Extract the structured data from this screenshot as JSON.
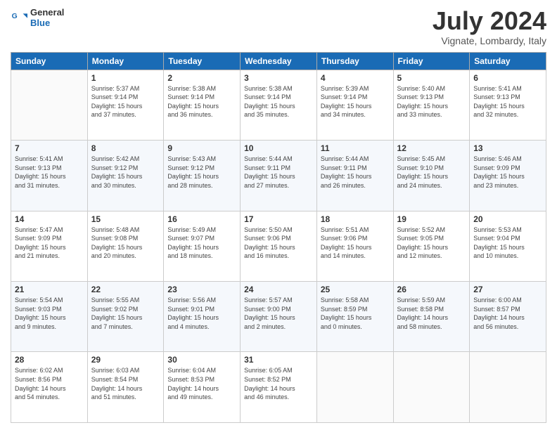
{
  "logo": {
    "line1": "General",
    "line2": "Blue"
  },
  "title": "July 2024",
  "location": "Vignate, Lombardy, Italy",
  "days_of_week": [
    "Sunday",
    "Monday",
    "Tuesday",
    "Wednesday",
    "Thursday",
    "Friday",
    "Saturday"
  ],
  "weeks": [
    [
      {
        "day": "",
        "info": ""
      },
      {
        "day": "1",
        "info": "Sunrise: 5:37 AM\nSunset: 9:14 PM\nDaylight: 15 hours\nand 37 minutes."
      },
      {
        "day": "2",
        "info": "Sunrise: 5:38 AM\nSunset: 9:14 PM\nDaylight: 15 hours\nand 36 minutes."
      },
      {
        "day": "3",
        "info": "Sunrise: 5:38 AM\nSunset: 9:14 PM\nDaylight: 15 hours\nand 35 minutes."
      },
      {
        "day": "4",
        "info": "Sunrise: 5:39 AM\nSunset: 9:14 PM\nDaylight: 15 hours\nand 34 minutes."
      },
      {
        "day": "5",
        "info": "Sunrise: 5:40 AM\nSunset: 9:13 PM\nDaylight: 15 hours\nand 33 minutes."
      },
      {
        "day": "6",
        "info": "Sunrise: 5:41 AM\nSunset: 9:13 PM\nDaylight: 15 hours\nand 32 minutes."
      }
    ],
    [
      {
        "day": "7",
        "info": "Sunrise: 5:41 AM\nSunset: 9:13 PM\nDaylight: 15 hours\nand 31 minutes."
      },
      {
        "day": "8",
        "info": "Sunrise: 5:42 AM\nSunset: 9:12 PM\nDaylight: 15 hours\nand 30 minutes."
      },
      {
        "day": "9",
        "info": "Sunrise: 5:43 AM\nSunset: 9:12 PM\nDaylight: 15 hours\nand 28 minutes."
      },
      {
        "day": "10",
        "info": "Sunrise: 5:44 AM\nSunset: 9:11 PM\nDaylight: 15 hours\nand 27 minutes."
      },
      {
        "day": "11",
        "info": "Sunrise: 5:44 AM\nSunset: 9:11 PM\nDaylight: 15 hours\nand 26 minutes."
      },
      {
        "day": "12",
        "info": "Sunrise: 5:45 AM\nSunset: 9:10 PM\nDaylight: 15 hours\nand 24 minutes."
      },
      {
        "day": "13",
        "info": "Sunrise: 5:46 AM\nSunset: 9:09 PM\nDaylight: 15 hours\nand 23 minutes."
      }
    ],
    [
      {
        "day": "14",
        "info": "Sunrise: 5:47 AM\nSunset: 9:09 PM\nDaylight: 15 hours\nand 21 minutes."
      },
      {
        "day": "15",
        "info": "Sunrise: 5:48 AM\nSunset: 9:08 PM\nDaylight: 15 hours\nand 20 minutes."
      },
      {
        "day": "16",
        "info": "Sunrise: 5:49 AM\nSunset: 9:07 PM\nDaylight: 15 hours\nand 18 minutes."
      },
      {
        "day": "17",
        "info": "Sunrise: 5:50 AM\nSunset: 9:06 PM\nDaylight: 15 hours\nand 16 minutes."
      },
      {
        "day": "18",
        "info": "Sunrise: 5:51 AM\nSunset: 9:06 PM\nDaylight: 15 hours\nand 14 minutes."
      },
      {
        "day": "19",
        "info": "Sunrise: 5:52 AM\nSunset: 9:05 PM\nDaylight: 15 hours\nand 12 minutes."
      },
      {
        "day": "20",
        "info": "Sunrise: 5:53 AM\nSunset: 9:04 PM\nDaylight: 15 hours\nand 10 minutes."
      }
    ],
    [
      {
        "day": "21",
        "info": "Sunrise: 5:54 AM\nSunset: 9:03 PM\nDaylight: 15 hours\nand 9 minutes."
      },
      {
        "day": "22",
        "info": "Sunrise: 5:55 AM\nSunset: 9:02 PM\nDaylight: 15 hours\nand 7 minutes."
      },
      {
        "day": "23",
        "info": "Sunrise: 5:56 AM\nSunset: 9:01 PM\nDaylight: 15 hours\nand 4 minutes."
      },
      {
        "day": "24",
        "info": "Sunrise: 5:57 AM\nSunset: 9:00 PM\nDaylight: 15 hours\nand 2 minutes."
      },
      {
        "day": "25",
        "info": "Sunrise: 5:58 AM\nSunset: 8:59 PM\nDaylight: 15 hours\nand 0 minutes."
      },
      {
        "day": "26",
        "info": "Sunrise: 5:59 AM\nSunset: 8:58 PM\nDaylight: 14 hours\nand 58 minutes."
      },
      {
        "day": "27",
        "info": "Sunrise: 6:00 AM\nSunset: 8:57 PM\nDaylight: 14 hours\nand 56 minutes."
      }
    ],
    [
      {
        "day": "28",
        "info": "Sunrise: 6:02 AM\nSunset: 8:56 PM\nDaylight: 14 hours\nand 54 minutes."
      },
      {
        "day": "29",
        "info": "Sunrise: 6:03 AM\nSunset: 8:54 PM\nDaylight: 14 hours\nand 51 minutes."
      },
      {
        "day": "30",
        "info": "Sunrise: 6:04 AM\nSunset: 8:53 PM\nDaylight: 14 hours\nand 49 minutes."
      },
      {
        "day": "31",
        "info": "Sunrise: 6:05 AM\nSunset: 8:52 PM\nDaylight: 14 hours\nand 46 minutes."
      },
      {
        "day": "",
        "info": ""
      },
      {
        "day": "",
        "info": ""
      },
      {
        "day": "",
        "info": ""
      }
    ]
  ]
}
